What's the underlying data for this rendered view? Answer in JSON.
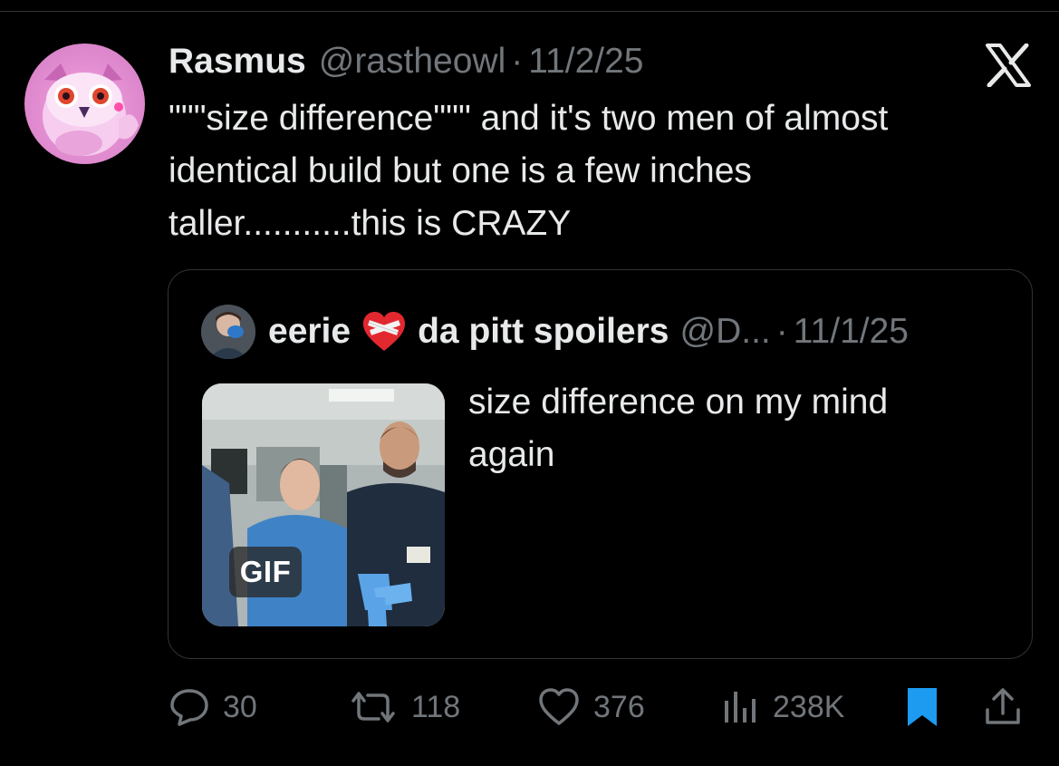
{
  "tweet": {
    "author": {
      "display_name": "Rasmus",
      "handle": "@rastheowl",
      "separator": "·",
      "date": "11/2/25"
    },
    "text_lines": [
      "\"\"\"size difference\"\"\" and it's two men of almost",
      "identical build but one is a few inches",
      "taller...........this is CRAZY"
    ],
    "platform_icon": "x-logo-icon"
  },
  "quote": {
    "author": {
      "name_part1": "eerie",
      "name_part2": "da pitt spoilers",
      "emoji": "mending-heart-icon",
      "handle": "@D...",
      "separator": "·",
      "date": "11/1/25"
    },
    "media": {
      "badge": "GIF"
    },
    "text_lines": [
      "size difference on my mind",
      "again"
    ]
  },
  "actions": {
    "replies": {
      "icon": "reply-icon",
      "count": "30"
    },
    "reposts": {
      "icon": "repost-icon",
      "count": "118"
    },
    "likes": {
      "icon": "heart-icon",
      "count": "376"
    },
    "views": {
      "icon": "views-chart-icon",
      "count": "238K"
    },
    "bookmark": {
      "icon": "bookmark-icon",
      "active": true
    },
    "share": {
      "icon": "share-icon"
    }
  },
  "colors": {
    "background": "#000000",
    "text_primary": "#e7e9ea",
    "text_secondary": "#71767b",
    "border": "#2f3336",
    "bookmark_active": "#1d9bf0"
  }
}
